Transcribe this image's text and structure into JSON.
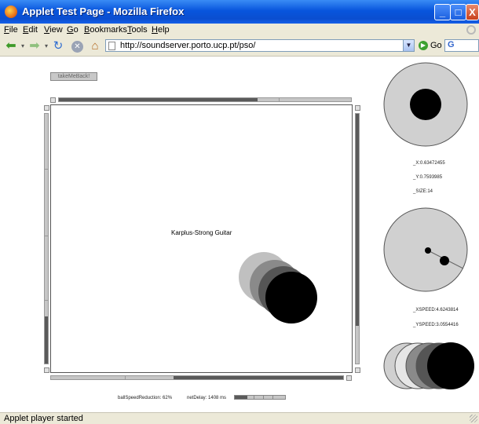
{
  "window": {
    "title": "Applet Test Page - Mozilla Firefox",
    "controls": {
      "minimize": "_",
      "maximize": "□",
      "close": "X"
    }
  },
  "menu": [
    "File",
    "Edit",
    "View",
    "Go",
    "Bookmarks",
    "Tools",
    "Help"
  ],
  "navbar": {
    "url": "http://soundserver.porto.ucp.pt/pso/",
    "go_label": "Go",
    "search_engine_glyph": "G"
  },
  "icons": {
    "back": "back-arrow-icon",
    "forward": "forward-arrow-icon",
    "reload": "reload-icon",
    "stop": "stop-icon",
    "home": "home-icon",
    "go": "go-arrow-icon"
  },
  "applet": {
    "take_me_back_label": "takeMeBack!",
    "instrument_label": "Karplus-Strong Guitar",
    "x_readout": "_X:0.63472455",
    "y_readout": "_Y:0.7593985",
    "size_readout": "_SIZE:14",
    "xspeed_readout": "_XSPEED:4.6243814",
    "yspeed_readout": "_YSPEED:3.0554416",
    "ball_speed_reduction": "ballSpeedReduction: 62%",
    "net_delay": "netDelay: 1408 ms",
    "top_slider_value": 0.68,
    "left_slider_value": 0.19,
    "right_slider_value": 0.85,
    "bottom_slider_value": 0.42
  },
  "status": {
    "text": "Applet player started"
  },
  "colors": {
    "titlebar_blue": "#0a4ed0",
    "ball_black": "#000000",
    "ball_dark_gray": "#555555",
    "ball_gray": "#8a8a8a",
    "ball_light_gray": "#c0c0c0",
    "pad_fill": "#d0d0d0"
  }
}
